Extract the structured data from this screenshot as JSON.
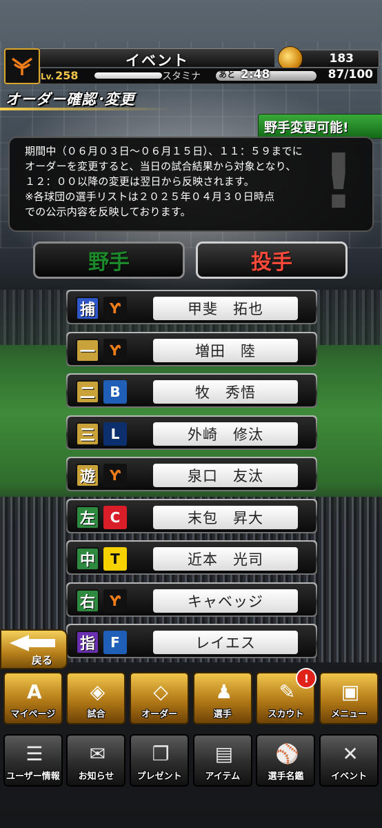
{
  "header": {
    "title": "イベント",
    "coins": "183",
    "level_prefix": "Lv.",
    "level": "258",
    "stamina_label": "スタミナ",
    "recover_prefix": "あと",
    "recover_timer": "2:48",
    "stamina": "87/100"
  },
  "page": {
    "title": "オーダー確認･変更",
    "status_badge": "野手変更可能!"
  },
  "notice": {
    "lines": [
      "期間中（０６月０３日〜０６月１５日）、１１：５９までに",
      "オーダーを変更すると、当日の試合結果から対象となり、",
      "１２：００以降の変更は翌日から反映されます。",
      "※各球団の選手リストは２０２５年０４月３０日時点",
      "での公示内容を反映しております。"
    ]
  },
  "tabs": {
    "fielder": "野手",
    "pitcher": "投手"
  },
  "lineup": [
    {
      "position": "捕",
      "team_icon": "giants-logo-icon",
      "team_mark": "Ƴ",
      "name": "甲斐　拓也"
    },
    {
      "position": "一",
      "team_icon": "giants-logo-icon",
      "team_mark": "Ƴ",
      "name": "増田　陸"
    },
    {
      "position": "二",
      "team_icon": "baystars-logo-icon",
      "team_mark": "B",
      "name": "牧　秀悟"
    },
    {
      "position": "三",
      "team_icon": "lions-logo-icon",
      "team_mark": "L",
      "name": "外崎　修汰"
    },
    {
      "position": "遊",
      "team_icon": "giants-logo-icon",
      "team_mark": "Ƴ",
      "name": "泉口　友汰"
    },
    {
      "position": "左",
      "team_icon": "carp-logo-icon",
      "team_mark": "C",
      "name": "末包　昇大"
    },
    {
      "position": "中",
      "team_icon": "tigers-logo-icon",
      "team_mark": "T",
      "name": "近本　光司"
    },
    {
      "position": "右",
      "team_icon": "giants-logo-icon",
      "team_mark": "Ƴ",
      "name": "キャベッジ"
    },
    {
      "position": "指",
      "team_icon": "fighters-logo-icon",
      "team_mark": "F",
      "name": "レイエス"
    }
  ],
  "back_button": "戻る",
  "menu_main": [
    {
      "label": "マイページ",
      "icon": "mypage-icon",
      "glyph": "A"
    },
    {
      "label": "試合",
      "icon": "stadium-icon",
      "glyph": "◈"
    },
    {
      "label": "オーダー",
      "icon": "field-order-icon",
      "glyph": "◇"
    },
    {
      "label": "選手",
      "icon": "player-icon",
      "glyph": "♟"
    },
    {
      "label": "スカウト",
      "icon": "scout-icon",
      "glyph": "✎",
      "badge": "!"
    },
    {
      "label": "メニュー",
      "icon": "menu-icon",
      "glyph": "▣"
    }
  ],
  "menu_sub": [
    {
      "label": "ユーザー情報",
      "icon": "user-info-icon",
      "glyph": "☰"
    },
    {
      "label": "お知らせ",
      "icon": "notice-icon",
      "glyph": "✉"
    },
    {
      "label": "プレゼント",
      "icon": "present-icon",
      "glyph": "❐"
    },
    {
      "label": "アイテム",
      "icon": "item-icon",
      "glyph": "▤"
    },
    {
      "label": "選手名鑑",
      "icon": "player-guide-icon",
      "glyph": "⚾"
    },
    {
      "label": "イベント",
      "icon": "event-icon",
      "glyph": "✕"
    }
  ],
  "colors": {
    "catcher": "#2f57c9",
    "infield": "#c9a23a",
    "outfield": "#2e8a3e",
    "dh": "#6a2fb0",
    "giants": "#f07d18",
    "baystars": "#1f5fb8",
    "lions": "#0c2f6e",
    "carp": "#d91e2a",
    "tigers": "#111111",
    "fighters": "#1f5fb8"
  }
}
